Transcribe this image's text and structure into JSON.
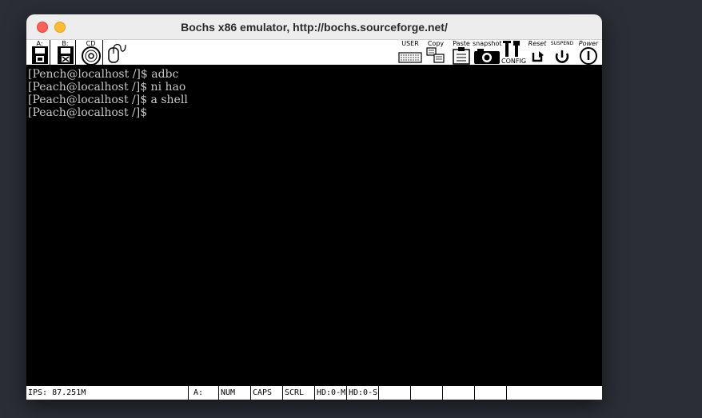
{
  "window": {
    "title": "Bochs x86 emulator, http://bochs.sourceforge.net/"
  },
  "toolbar": {
    "floppy_a_label": "A:",
    "floppy_b_label": "B:",
    "cdrom_label": "CD",
    "user_label": "USER",
    "copy_label": "Copy",
    "paste_label": "Paste",
    "snapshot_label": "snapshot",
    "config_label": "CONFIG",
    "reset_label": "Reset",
    "suspend_label": "SUSPEND",
    "power_label": "Power"
  },
  "terminal": {
    "lines": [
      "[Pench@localhost /]$ adbc",
      "[Peach@localhost /]$ ni hao",
      "[Peach@localhost /]$ a shell",
      "[Peach@localhost /]$"
    ]
  },
  "statusbar": {
    "ips": "IPS: 87.251M",
    "floppy": "A:",
    "num": "NUM",
    "caps": "CAPS",
    "scrl": "SCRL",
    "hd0m": "HD:0-M",
    "hd0s": "HD:0-S",
    "cells": [
      "",
      "",
      "",
      ""
    ]
  },
  "icons": {
    "floppy": "floppy-disk-icon",
    "cdrom": "cdrom-icon",
    "mouse": "mouse-icon",
    "keyboard": "keyboard-icon",
    "copy": "copy-icon",
    "paste": "clipboard-icon",
    "snapshot": "camera-icon",
    "config": "wrench-icon",
    "reset": "reset-arrow-icon",
    "suspend": "suspend-icon",
    "power": "power-icon"
  },
  "colors": {
    "close": "#fe5f57",
    "minimize": "#febc2e",
    "terminal_bg": "#000000",
    "terminal_fg": "#c8c8c8"
  }
}
